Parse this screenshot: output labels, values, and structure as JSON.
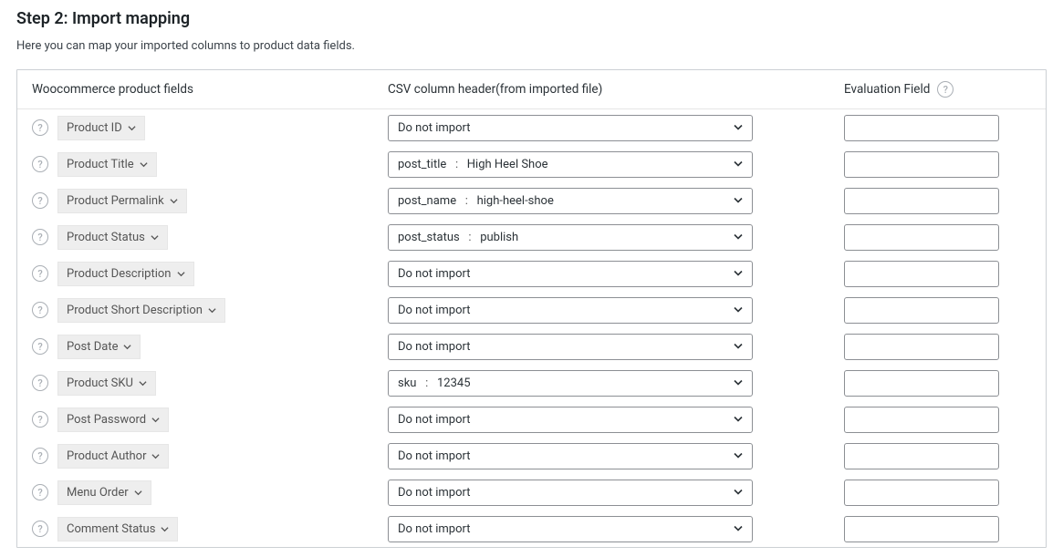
{
  "header": {
    "title": "Step 2: Import mapping",
    "subtitle": "Here you can map your imported columns to product data fields."
  },
  "table": {
    "headers": {
      "field": "Woocommerce product fields",
      "csv": "CSV column header(from imported file)",
      "eval": "Evaluation Field"
    },
    "default_option": "Do not import",
    "separator": "   :   ",
    "rows": [
      {
        "field": "Product ID",
        "csv_col": "",
        "csv_val": "",
        "eval": ""
      },
      {
        "field": "Product Title",
        "csv_col": "post_title",
        "csv_val": "High Heel Shoe",
        "eval": ""
      },
      {
        "field": "Product Permalink",
        "csv_col": "post_name",
        "csv_val": "high-heel-shoe",
        "eval": ""
      },
      {
        "field": "Product Status",
        "csv_col": "post_status",
        "csv_val": "publish",
        "eval": ""
      },
      {
        "field": "Product Description",
        "csv_col": "",
        "csv_val": "",
        "eval": ""
      },
      {
        "field": "Product Short Description",
        "csv_col": "",
        "csv_val": "",
        "eval": ""
      },
      {
        "field": "Post Date",
        "csv_col": "",
        "csv_val": "",
        "eval": ""
      },
      {
        "field": "Product SKU",
        "csv_col": "sku",
        "csv_val": "12345",
        "eval": ""
      },
      {
        "field": "Post Password",
        "csv_col": "",
        "csv_val": "",
        "eval": ""
      },
      {
        "field": "Product Author",
        "csv_col": "",
        "csv_val": "",
        "eval": ""
      },
      {
        "field": "Menu Order",
        "csv_col": "",
        "csv_val": "",
        "eval": ""
      },
      {
        "field": "Comment Status",
        "csv_col": "",
        "csv_val": "",
        "eval": ""
      }
    ]
  }
}
